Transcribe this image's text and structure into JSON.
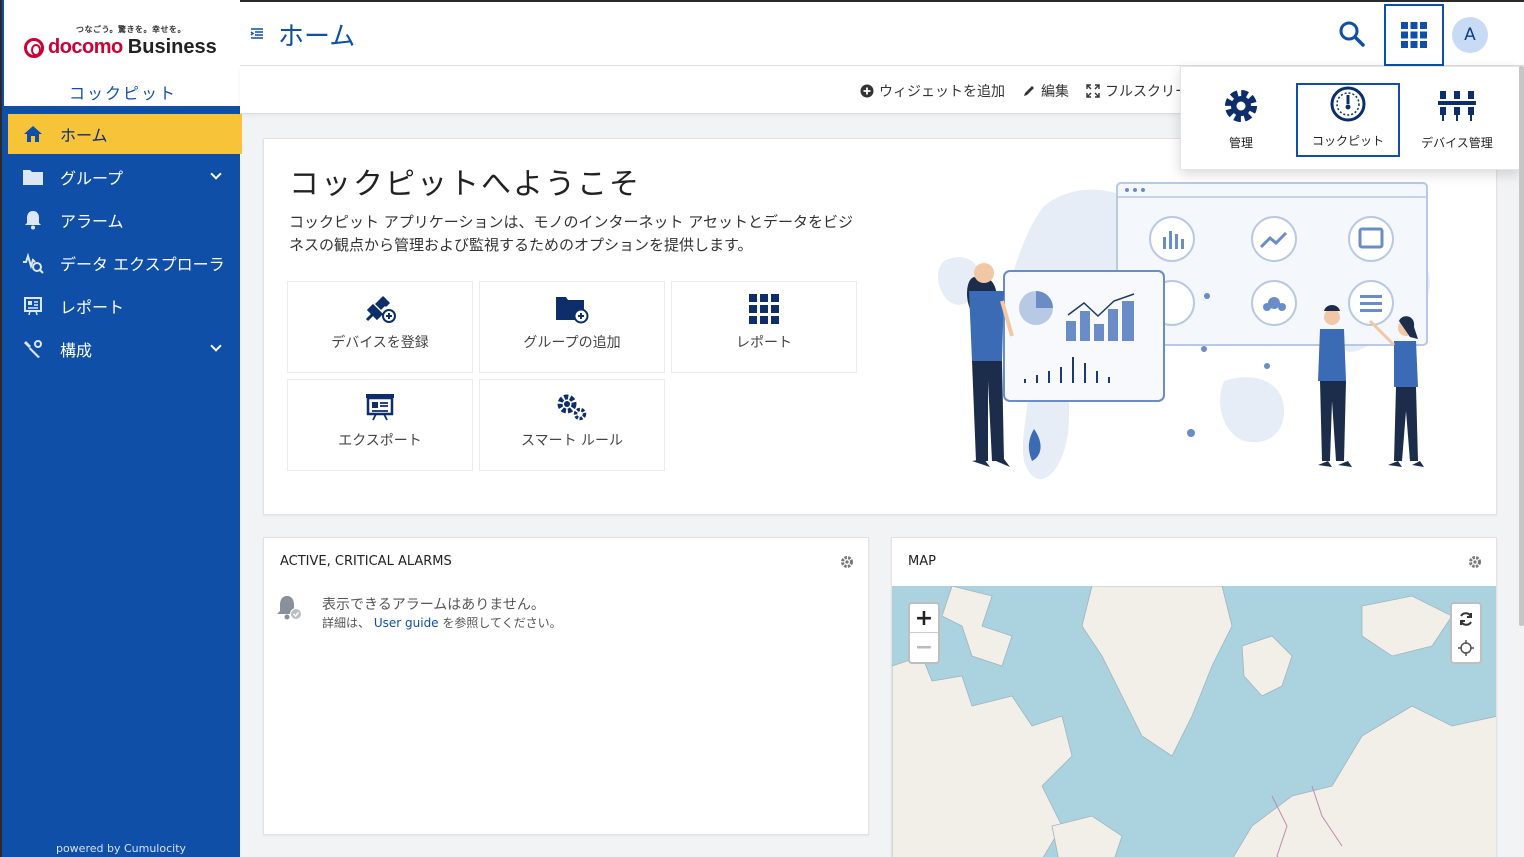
{
  "brand": {
    "tagline": "つなごう。驚きを。幸せを。",
    "name_docomo": "docomo",
    "name_business": "Business",
    "app_name": "コックピット"
  },
  "sidebar": {
    "items": [
      {
        "label": "ホーム",
        "icon": "home-icon",
        "active": true
      },
      {
        "label": "グループ",
        "icon": "folder-icon",
        "expandable": true
      },
      {
        "label": "アラーム",
        "icon": "bell-icon"
      },
      {
        "label": "データ エクスプローラ",
        "icon": "data-explorer-icon"
      },
      {
        "label": "レポート",
        "icon": "report-icon"
      },
      {
        "label": "構成",
        "icon": "configuration-icon",
        "expandable": true
      }
    ],
    "powered_by": "powered by Cumulocity"
  },
  "header": {
    "title": "ホーム",
    "avatar_initial": "A"
  },
  "actionbar": {
    "add_widget": "ウィジェットを追加",
    "edit": "編集",
    "fullscreen": "フルスクリー"
  },
  "apps_dropdown": {
    "items": [
      {
        "label": "管理",
        "icon": "gear-icon"
      },
      {
        "label": "コックピット",
        "icon": "gauge-icon",
        "selected": true
      },
      {
        "label": "デバイス管理",
        "icon": "device-management-icon"
      }
    ]
  },
  "welcome": {
    "title": "コックピットへようこそ",
    "description": "コックピット アプリケーションは、モノのインターネット アセットとデータをビジネスの観点から管理および監視するためのオプションを提供します。",
    "tiles": [
      {
        "label": "デバイスを登録",
        "icon": "plug-add-icon"
      },
      {
        "label": "グループの追加",
        "icon": "folder-add-icon"
      },
      {
        "label": "レポート",
        "icon": "grid-icon"
      },
      {
        "label": "エクスポート",
        "icon": "presentation-icon"
      },
      {
        "label": "スマート ルール",
        "icon": "gears-icon"
      }
    ]
  },
  "alarms_widget": {
    "title": "ACTIVE, CRITICAL ALARMS",
    "empty_message": "表示できるアラームはありません。",
    "detail_prefix": "詳細は、",
    "detail_link": "User guide",
    "detail_suffix": "を参照してください。"
  },
  "map_widget": {
    "title": "MAP",
    "zoom_in": "+",
    "zoom_out": "−"
  },
  "colors": {
    "primary": "#0f4fa8",
    "active_nav": "#f7c339",
    "brand_red": "#cc0033",
    "sea": "#aad3df",
    "land": "#f2efe9"
  }
}
